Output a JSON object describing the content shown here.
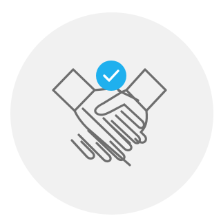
{
  "colors": {
    "background": "#ffffff",
    "circle": "#f1f1f1",
    "outline": "#6e6e6e",
    "check_badge": "#1fb0ee",
    "check_mark": "#ffffff"
  },
  "icons": {
    "main": "handshake-icon",
    "badge": "checkmark-icon"
  }
}
